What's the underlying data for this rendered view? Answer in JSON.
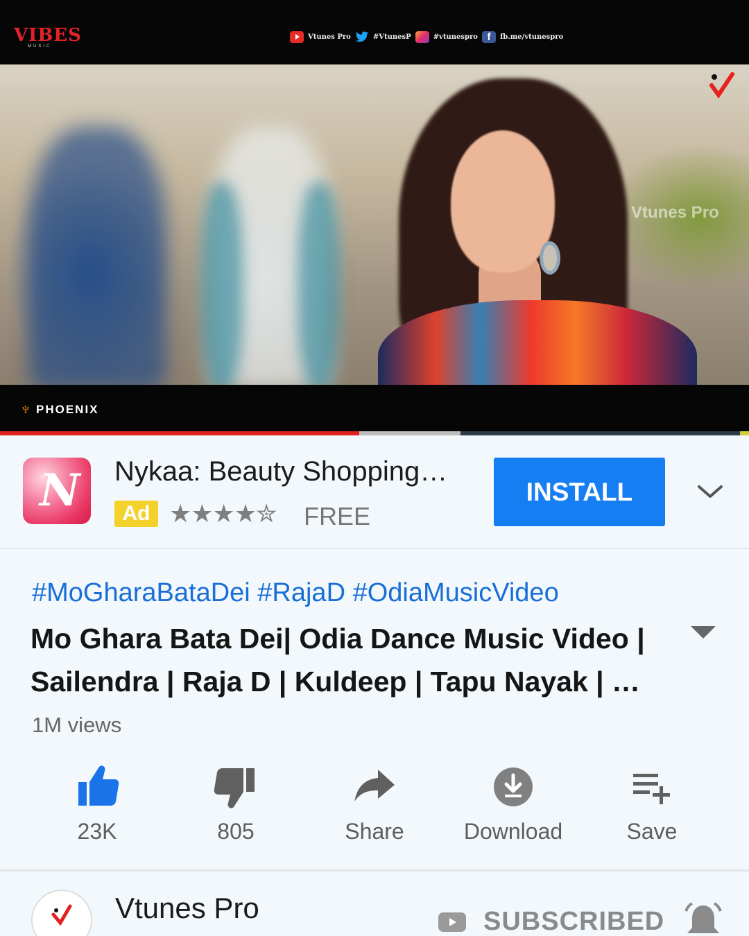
{
  "player": {
    "top_logo": "VIBES",
    "top_logo_sub": "MUSIC",
    "socials": [
      {
        "icon": "youtube-icon",
        "text": "Vtunes Pro"
      },
      {
        "icon": "twitter-icon",
        "text": "#VtunesP"
      },
      {
        "icon": "instagram-icon",
        "text": "#vtunespro"
      },
      {
        "icon": "facebook-icon",
        "text": "fb.me/vtunespro"
      }
    ],
    "watermark": "Vtunes Pro",
    "bottom_logo": "PHOENIX",
    "progress_played": 0.48,
    "progress_buffered": 0.615
  },
  "ad": {
    "app_name": "Nykaa: Beauty Shopping…",
    "badge": "Ad",
    "stars": "★★★★✮",
    "rating": 4.5,
    "price": "FREE",
    "install_label": "INSTALL"
  },
  "video": {
    "hashtags": "#MoGharaBataDei #RajaD #OdiaMusicVideo",
    "title": "Mo Ghara Bata Dei| Odia Dance Music Video | Sailendra | Raja D | Kuldeep | Tapu Nayak | …",
    "views": "1M views"
  },
  "actions": {
    "like": "23K",
    "dislike": "805",
    "share": "Share",
    "download": "Download",
    "save": "Save"
  },
  "channel": {
    "name": "Vtunes Pro",
    "subscribe_label": "SUBSCRIBED"
  },
  "colors": {
    "accent_blue": "#167ef3",
    "hashtag_blue": "#1a6ed8",
    "like_blue": "#1a73e8",
    "progress_red": "#e0231f",
    "ad_yellow": "#f3d22b"
  }
}
